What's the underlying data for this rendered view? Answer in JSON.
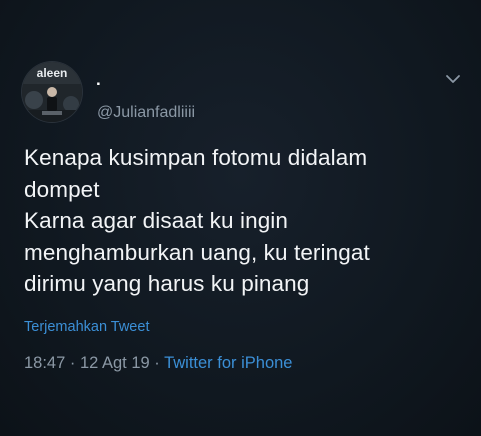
{
  "tweet": {
    "author": {
      "display_name": ".",
      "handle": "@Julianfadliiii",
      "avatar_text": "aleen"
    },
    "text": "Kenapa kusimpan fotomu didalam\ndompet\nKarna agar disaat ku ingin\nmenghamburkan uang, ku teringat\ndirimu yang harus ku pinang",
    "translate_label": "Terjemahkan Tweet",
    "time": "18:47",
    "separator": " · ",
    "date": "12 Agt 19",
    "source": "Twitter for iPhone"
  },
  "icons": {
    "menu": "chevron-down-icon"
  },
  "colors": {
    "background": "#101820",
    "text": "#f2f4f6",
    "secondary": "#8b98a5",
    "link": "#3b8fd6"
  }
}
